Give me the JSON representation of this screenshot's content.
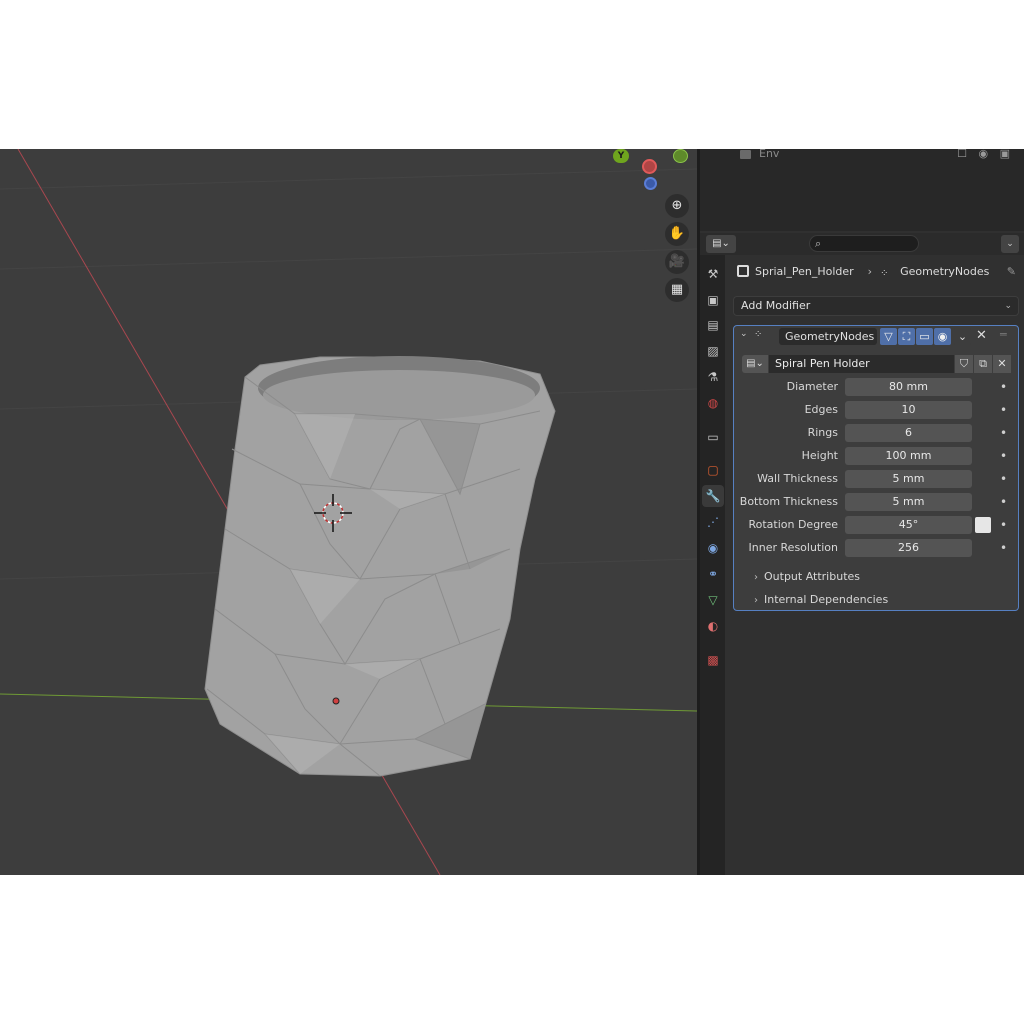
{
  "outliner": {
    "row_label": "Env",
    "vis_icons": "☐ ◉ ▣"
  },
  "viewport": {
    "gizmo_y_label": "Y",
    "nav_buttons": [
      "zoom-icon",
      "hand-icon",
      "camera-icon",
      "grid-icon"
    ],
    "nav_glyphs": [
      "⊕",
      "✋",
      "🎥",
      "▦"
    ]
  },
  "properties": {
    "editor_type_glyph": "▤⌄",
    "search_glyph": "⌕",
    "header_dropdown_glyph": "⌄",
    "tabs": [
      {
        "name": "tool",
        "glyph": "⚒"
      },
      {
        "name": "render",
        "glyph": "▣"
      },
      {
        "name": "output",
        "glyph": "▤"
      },
      {
        "name": "view-layer",
        "glyph": "▨"
      },
      {
        "name": "scene",
        "glyph": "⚗"
      },
      {
        "name": "world",
        "glyph": "◍"
      },
      {
        "name": "collection",
        "glyph": "▭"
      },
      {
        "name": "object",
        "glyph": "▢"
      },
      {
        "name": "modifiers",
        "glyph": "🔧"
      },
      {
        "name": "particles",
        "glyph": "⋰"
      },
      {
        "name": "physics",
        "glyph": "◉"
      },
      {
        "name": "constraints",
        "glyph": "⚭"
      },
      {
        "name": "data",
        "glyph": "▽"
      },
      {
        "name": "material",
        "glyph": "◐"
      },
      {
        "name": "texture",
        "glyph": "▩"
      }
    ],
    "breadcrumb": {
      "object": "Sprial_Pen_Holder",
      "separator": "›",
      "modifier": "GeometryNodes"
    },
    "add_modifier_label": "Add Modifier",
    "add_modifier_chevron": "⌄",
    "modifier": {
      "collapse_glyph": "⌄",
      "name": "GeometryNodes",
      "close_glyph": "✕",
      "grip_glyph": "═",
      "node_group": "Spiral Pen Holder",
      "node_type_glyph": "▤⌄",
      "params": [
        {
          "label": "Diameter",
          "value": "80 mm"
        },
        {
          "label": "Edges",
          "value": "10"
        },
        {
          "label": "Rings",
          "value": "6"
        },
        {
          "label": "Height",
          "value": "100 mm"
        },
        {
          "label": "Wall Thickness",
          "value": "5 mm"
        },
        {
          "label": "Bottom Thickness",
          "value": "5 mm"
        },
        {
          "label": "Rotation Degree",
          "value": "45°"
        },
        {
          "label": "Inner Resolution",
          "value": "256"
        }
      ],
      "dot_glyph": "•",
      "sub_panels": [
        {
          "label": "Output Attributes",
          "glyph": "›"
        },
        {
          "label": "Internal Dependencies",
          "glyph": "›"
        }
      ]
    }
  },
  "colors": {
    "accent": "#5680c2",
    "viewport_bg": "#3d3d3d",
    "panel_bg": "#303030",
    "x_axis": "#b0474f",
    "y_axis": "#7aa33a",
    "mesh": "#a4a4a4"
  }
}
